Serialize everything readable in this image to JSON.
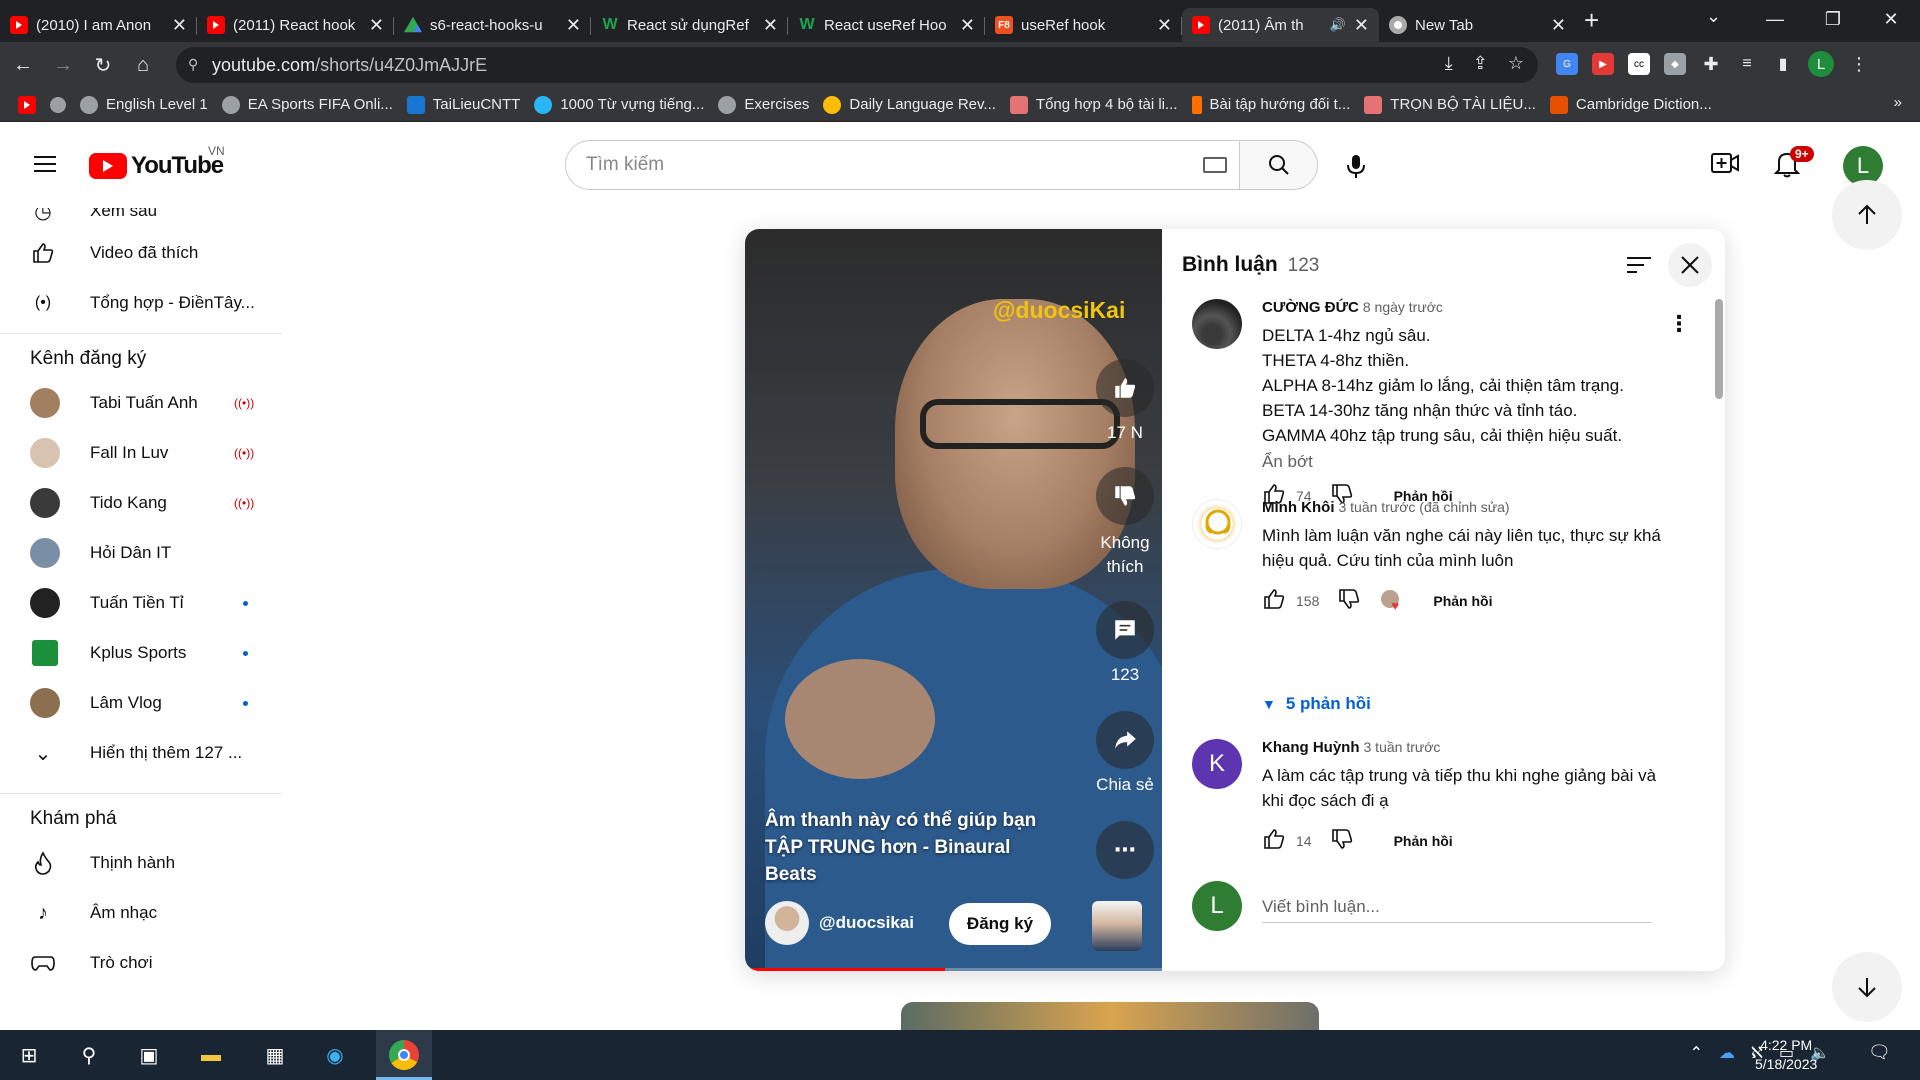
{
  "browser": {
    "tabs": [
      {
        "favicon": "youtube-icon",
        "title": "(2010) I am Anon"
      },
      {
        "favicon": "youtube-icon",
        "title": "(2011) React hook"
      },
      {
        "favicon": "google-drive-icon",
        "title": "s6-react-hooks-u"
      },
      {
        "favicon": "w-icon",
        "title": "React sử dụngRef"
      },
      {
        "favicon": "w-icon",
        "title": "React useRef Hoo"
      },
      {
        "favicon": "f8-icon",
        "title": "useRef hook"
      },
      {
        "favicon": "youtube-icon",
        "title": "(2011) Âm th"
      },
      {
        "favicon": "chrome-icon",
        "title": "New Tab"
      }
    ],
    "f8_label": "F8",
    "url_host": "youtube.com",
    "url_path": "/shorts/u4Z0JmAJJrE",
    "profile_initial": "L",
    "bookmarks": [
      "English Level 1",
      "EA Sports FIFA Onli...",
      "TaiLieuCNTT",
      "1000 Từ vựng tiếng...",
      "Exercises",
      "Daily Language Rev...",
      "Tổng hợp 4 bộ tài li...",
      "Bài tập hướng đối t...",
      "TRỌN BỘ TÀI LIỆU...",
      "Cambridge Diction..."
    ]
  },
  "youtube": {
    "logo_text": "YouTube",
    "country": "VN",
    "search_placeholder": "Tìm kiếm",
    "notif_badge": "9+",
    "avatar_initial": "L",
    "sidebar": {
      "top_items": [
        {
          "icon": "clock-icon",
          "label": "Xem sau"
        },
        {
          "icon": "thumbs-up-icon",
          "label": "Video đã thích"
        },
        {
          "icon": "broadcast-icon",
          "label": "Tổng hợp - ĐiềnTây..."
        }
      ],
      "subs_heading": "Kênh đăng ký",
      "subscriptions": [
        {
          "name": "Tabi Tuấn Anh",
          "status": "live"
        },
        {
          "name": "Fall In Luv",
          "status": "live"
        },
        {
          "name": "Tido Kang",
          "status": "live"
        },
        {
          "name": "Hỏi Dân IT",
          "status": "none"
        },
        {
          "name": "Tuấn Tiền Tỉ",
          "status": "new"
        },
        {
          "name": "Kplus Sports",
          "status": "new"
        },
        {
          "name": "Lâm Vlog",
          "status": "new"
        }
      ],
      "show_more": "Hiển thị thêm 127 ...",
      "explore_heading": "Khám phá",
      "explore": [
        {
          "icon": "flame-icon",
          "label": "Thịnh hành"
        },
        {
          "icon": "music-note-icon",
          "label": "Âm nhạc"
        },
        {
          "icon": "gamepad-icon",
          "label": "Trò chơi"
        }
      ]
    },
    "short": {
      "watermark": "@duocsiKai",
      "title": "Âm thanh này có thể giúp bạn TẬP TRUNG hơn - Binaural Beats",
      "channel": "@duocsikai",
      "subscribe_label": "Đăng ký",
      "likes": "17 N",
      "dislike_label": "Không thích",
      "comments_count": "123",
      "share_label": "Chia sẻ",
      "progress_fraction": 0.48
    },
    "comments": {
      "title": "Bình luận",
      "count": "123",
      "items": [
        {
          "author": "CƯỜNG ĐỨC",
          "time": "8 ngày trước",
          "lines": [
            "DELTA 1-4hz ngủ sâu.",
            "THETA 4-8hz thiền.",
            "ALPHA 8-14hz giảm lo lắng, cải thiện tâm trạng.",
            "BETA 14-30hz tăng nhận thức và tỉnh táo.",
            "GAMMA 40hz tập trung sâu, cải thiện hiệu suất."
          ],
          "show_less": "Ẩn bớt",
          "likes": "74",
          "reply_label": "Phản hồi"
        },
        {
          "author": "Minh Khôi",
          "time": "3 tuần trước (đã chỉnh sửa)",
          "text": "Mình làm luận văn nghe cái này liên tục, thực sự khá hiệu quả. Cứu tinh của mình luôn",
          "likes": "158",
          "reply_label": "Phản hồi",
          "replies_label": "5 phản hồi"
        },
        {
          "author": "Khang Huỳnh",
          "time": "3 tuần trước",
          "avatar_initial": "K",
          "text": "A làm các tập trung và tiếp thu khi nghe giảng bài và khi đọc sách đi ạ",
          "likes": "14",
          "reply_label": "Phản hồi"
        }
      ],
      "add_placeholder": "Viết bình luận...",
      "add_avatar_initial": "L"
    }
  },
  "taskbar": {
    "time": "4:22 PM",
    "date": "5/18/2023",
    "notif_count": "1"
  },
  "colors": {
    "youtube_red": "#ff0000",
    "link_blue": "#065fd4",
    "avatar_green": "#2e7d32",
    "khang_purple": "#5e35b1",
    "taskbar": "#1a2533"
  }
}
